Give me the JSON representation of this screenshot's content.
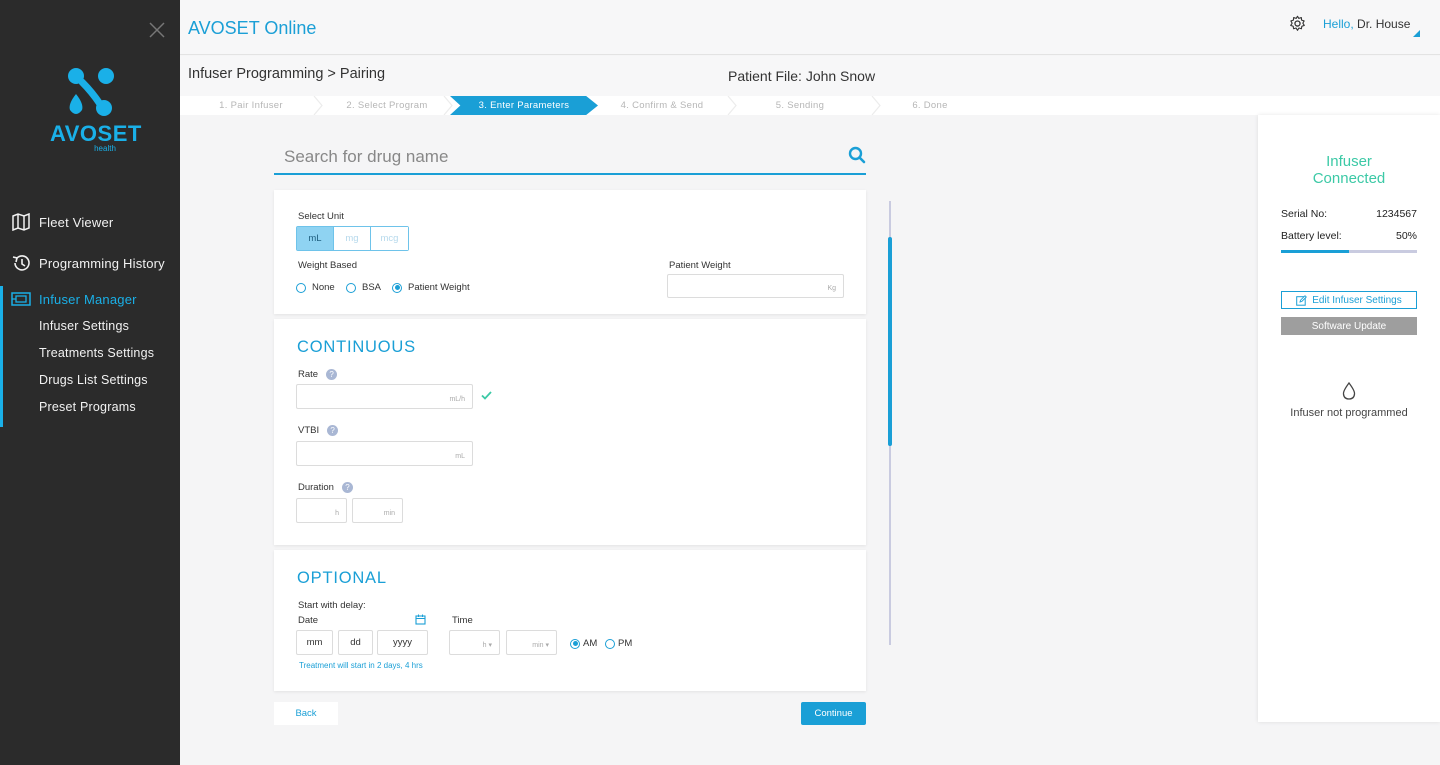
{
  "app": {
    "title": "AVOSET Online",
    "logo_text": "AVOSET",
    "logo_sub": "health"
  },
  "user": {
    "greeting": "Hello,",
    "name": "Dr. House"
  },
  "sidebar": {
    "items": [
      {
        "label": "Fleet Viewer",
        "icon": "map-icon"
      },
      {
        "label": "Programming History",
        "icon": "history-icon"
      },
      {
        "label": "Infuser Manager",
        "icon": "infuser-icon",
        "active": true
      }
    ],
    "sub_items": [
      "Infuser Settings",
      "Treatments Settings",
      "Drugs List Settings",
      "Preset Programs"
    ]
  },
  "breadcrumb": "Infuser Programming > Pairing",
  "patient_file": "Patient File: John Snow",
  "steps": [
    "1. Pair Infuser",
    "2. Select Program",
    "3. Enter Parameters",
    "4. Confirm & Send",
    "5. Sending",
    "6. Done"
  ],
  "active_step": 2,
  "search": {
    "placeholder": "Search for drug name"
  },
  "units": {
    "label": "Select Unit",
    "options": [
      "mL",
      "mg",
      "mcg"
    ],
    "selected": "mL"
  },
  "weight": {
    "label": "Weight Based",
    "options": [
      "None",
      "BSA",
      "Patient Weight"
    ],
    "selected": "Patient Weight",
    "patient_weight_label": "Patient Weight",
    "patient_weight_unit": "Kg"
  },
  "continuous": {
    "title": "CONTINUOUS",
    "rate_label": "Rate",
    "rate_unit": "mL/h",
    "vtbi_label": "VTBI",
    "vtbi_unit": "mL",
    "duration_label": "Duration",
    "duration_h_unit": "h",
    "duration_min_unit": "min"
  },
  "optional": {
    "title": "OPTIONAL",
    "delay_label": "Start with delay:",
    "date_label": "Date",
    "time_label": "Time",
    "mm": "mm",
    "dd": "dd",
    "yyyy": "yyyy",
    "hour_unit": "h",
    "min_unit": "min",
    "am": "AM",
    "pm": "PM",
    "ampm_selected": "AM",
    "hint": "Treatment will start in 2 days, 4 hrs"
  },
  "buttons": {
    "back": "Back",
    "continue": "Continue"
  },
  "infuser": {
    "status_line1": "Infuser",
    "status_line2": "Connected",
    "serial_label": "Serial No:",
    "serial_value": "1234567",
    "battery_label": "Battery level:",
    "battery_value": "50%",
    "battery_fraction": 0.5,
    "edit_label": "Edit Infuser Settings",
    "software_label": "Software Update",
    "not_programmed": "Infuser not programmed"
  },
  "colors": {
    "accent": "#1a9fd6",
    "connected": "#3cc9a6",
    "sidebar_bg": "#2b2b2b"
  }
}
